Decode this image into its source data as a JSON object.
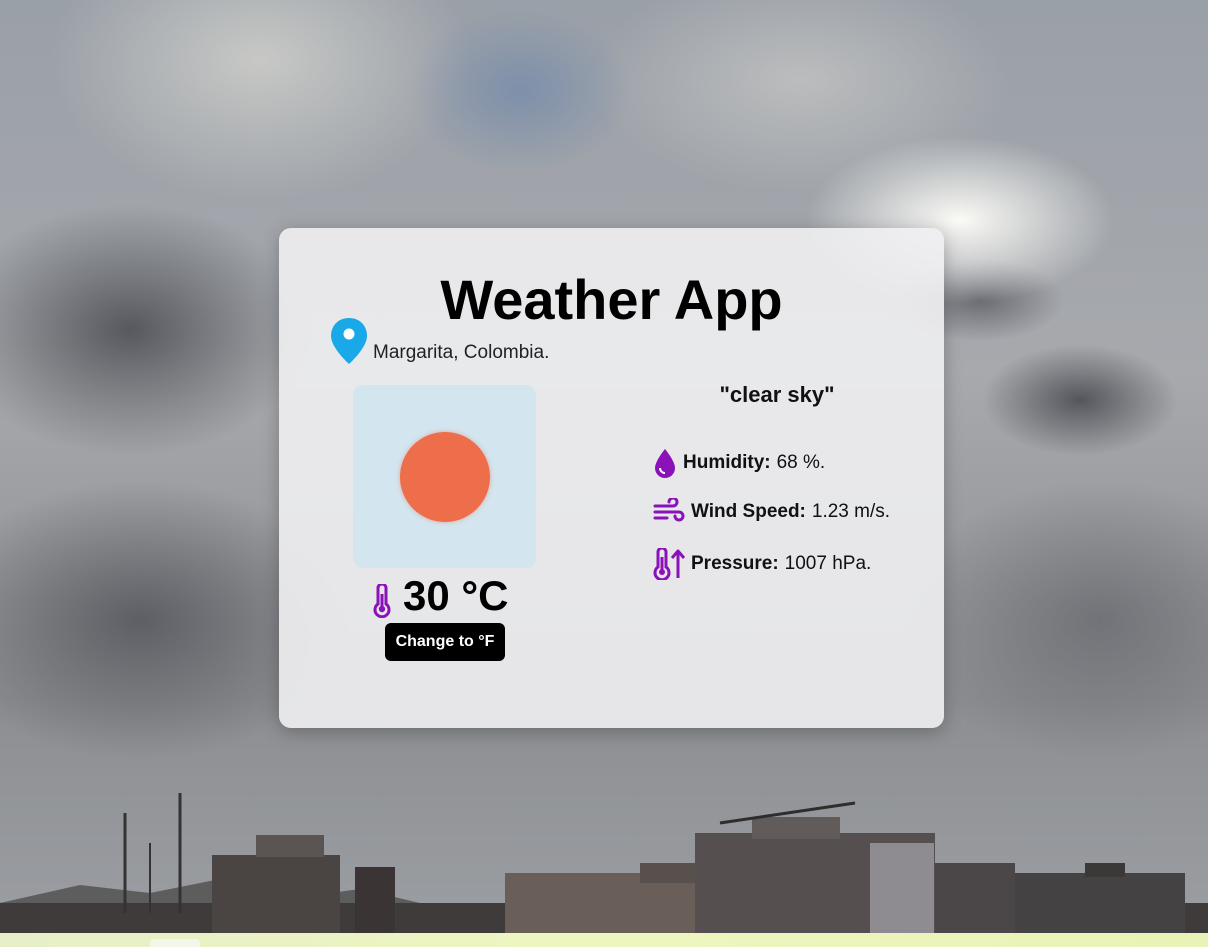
{
  "app": {
    "title": "Weather App"
  },
  "location": {
    "text": "Margarita, Colombia."
  },
  "current": {
    "description": "\"clear sky\"",
    "temperature": "30 °C",
    "toggle_label": "Change to °F"
  },
  "stats": {
    "humidity": {
      "label": "Humidity:",
      "value": "68 %."
    },
    "wind": {
      "label": "Wind Speed:",
      "value": "1.23 m/s."
    },
    "pressure": {
      "label": "Pressure:",
      "value": "1007 hPa."
    }
  },
  "icons": {
    "location": "map-pin-icon",
    "weather": "sun-icon",
    "temperature": "thermometer-icon",
    "humidity": "water-drop-icon",
    "wind": "wind-icon",
    "pressure": "thermometer-arrow-icon"
  },
  "colors": {
    "accent_purple": "#8a12b8",
    "pin_blue": "#1aa9e8",
    "sun_orange": "#ee6e4b",
    "button_bg": "#000000"
  }
}
